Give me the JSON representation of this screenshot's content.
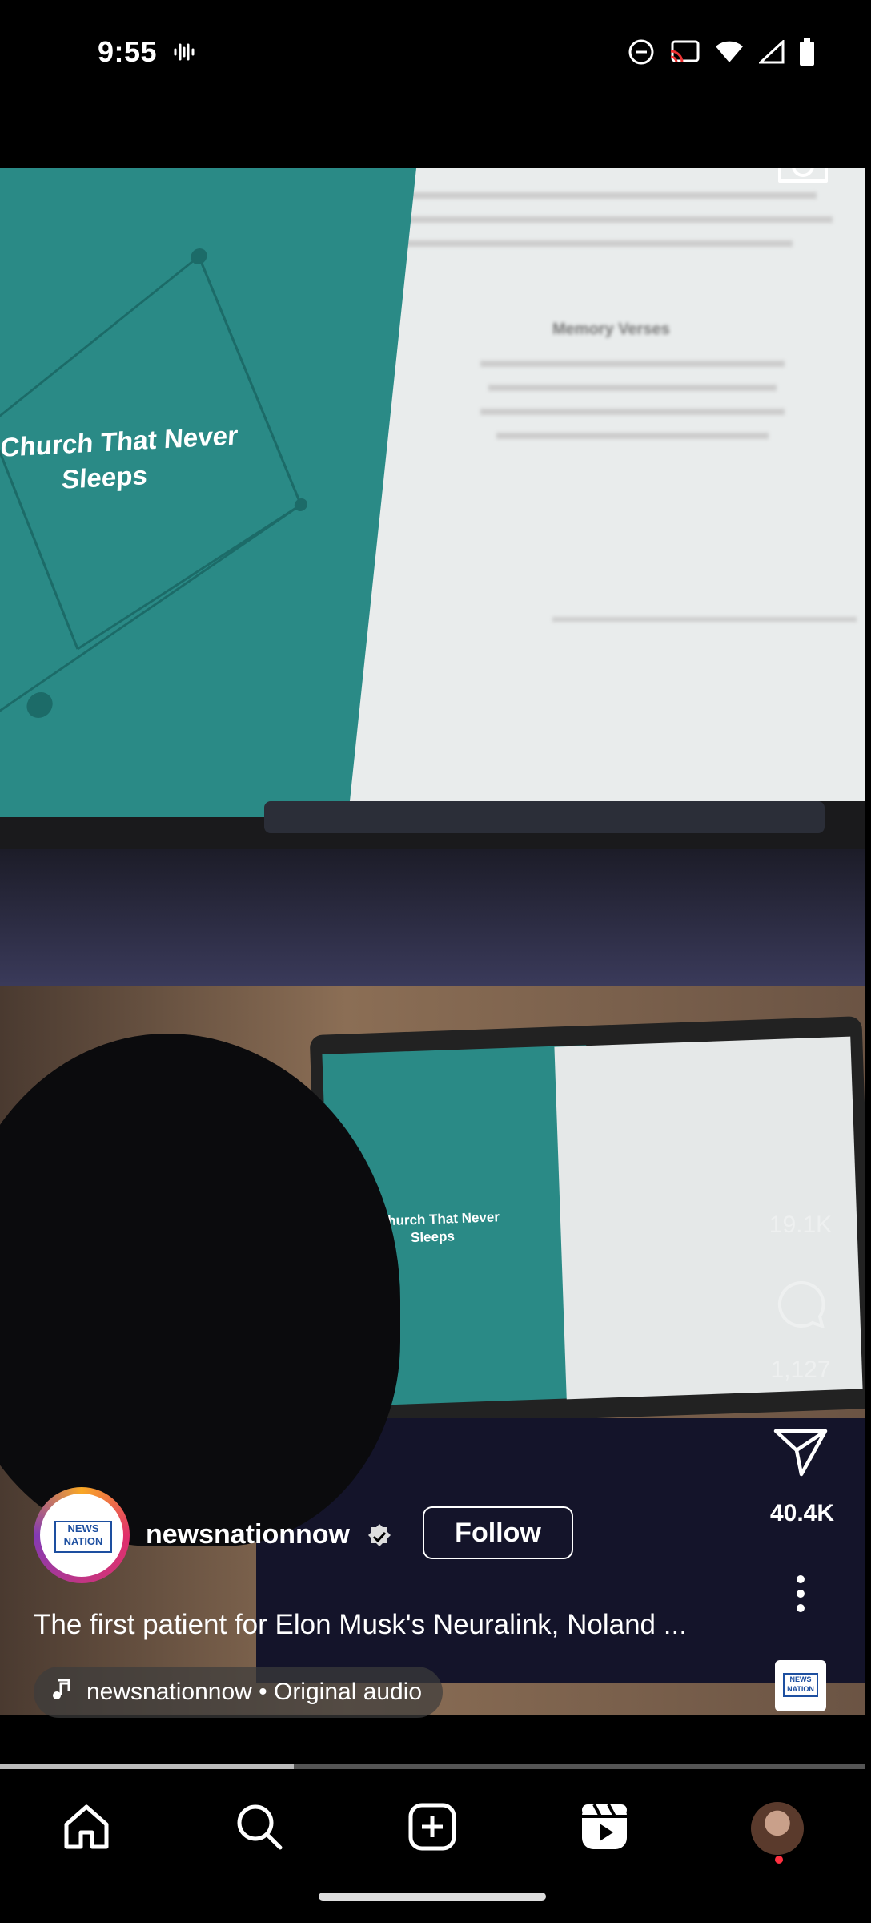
{
  "status_bar": {
    "time": "9:55",
    "icons": [
      "vibrate-icon",
      "do-not-disturb-icon",
      "cast-icon",
      "wifi-icon",
      "signal-icon",
      "battery-icon"
    ]
  },
  "camera_icon": "camera-icon",
  "video": {
    "screen_title": "A Church That Never Sleeps",
    "screen_subtitle": "Memory Verses"
  },
  "actions": {
    "likes": "19.1K",
    "comments": "1,127",
    "shares": "40.4K"
  },
  "account": {
    "avatar_text": "NEWS NATION",
    "username": "newsnationnow",
    "follow_label": "Follow"
  },
  "caption": "The first patient for Elon Musk's Neuralink, Noland ...",
  "audio": "newsnationnow • Original audio",
  "reel_thumb_text": "NEWS NATION",
  "progress": 0.34,
  "nav": {
    "items": [
      "home-icon",
      "search-icon",
      "create-icon",
      "reels-icon",
      "profile-avatar"
    ]
  },
  "colors": {
    "background": "#000000",
    "teal": "#2a8a86",
    "notification_dot": "#ff3040"
  }
}
